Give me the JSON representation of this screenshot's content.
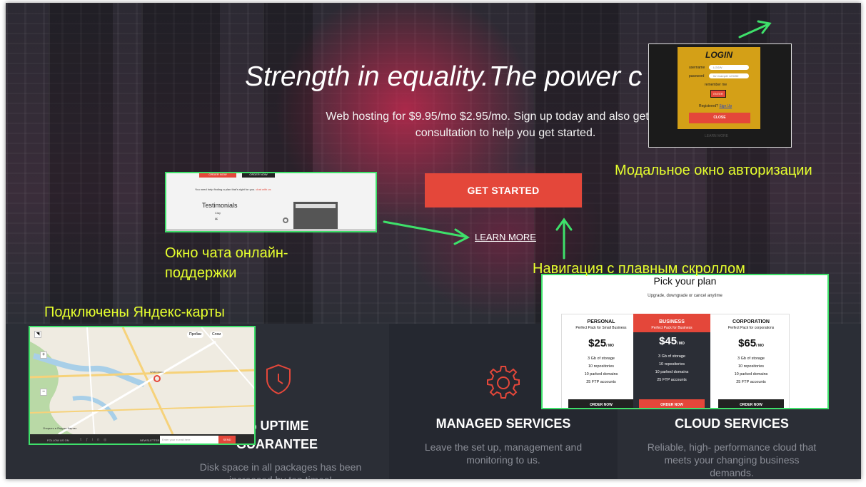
{
  "hero": {
    "title": "Strength in equality.The power c",
    "subtitle": "Web hosting for $9.95/mo $2.95/mo. Sign up today and also get 1-on-1 consultation to help you get started.",
    "cta_label": "GET STARTED",
    "learn_more_label": "LEARN MORE"
  },
  "features": [
    {
      "title": "% UPTIME\nGUARANTEE",
      "desc": "Disk space in all packages has been increased by ten times!",
      "icon": "shield-icon"
    },
    {
      "title": "MANAGED SERVICES",
      "desc": "Leave the set up, management and monitoring to us.",
      "icon": "gear-icon"
    },
    {
      "title": "CLOUD SERVICES",
      "desc": "Reliable, high- performance cloud that meets your changing business demands.",
      "icon": "cloud-icon"
    }
  ],
  "annotations": {
    "login": "Модальное окно авторизации",
    "chat": "Окно чата онлайн-\nподдержки",
    "nav": "Навигация с плавным скроллом",
    "maps": "Подключены Яндекс-карты"
  },
  "login_modal": {
    "title": "LOGIN",
    "username_label": "username",
    "username_placeholder": "LOGIN",
    "password_label": "password",
    "password_placeholder": "for example 123456",
    "remember_label": "remember me",
    "enter_label": "ENTER",
    "registered_text": "Registered?",
    "signup_label": "Sign Up",
    "close_label": "CLOSE",
    "learn_more_faint": "LEARN MORE"
  },
  "chat_window": {
    "order_label_1": "ORDER NOW",
    "order_label_2": "ORDER NOW",
    "intro": "You need help finding a plan that's right for you.",
    "intro_link": "chat with us",
    "testimonials_title": "Testimonials",
    "testimonial_name": "Clay",
    "quote_mark": "“"
  },
  "map_window": {
    "traffic_label": "Пробки",
    "layers_label": "Слои",
    "marker_label": "WebCloud",
    "open_in": "Открыть в Яндекс.Картах",
    "follow_label": "FOLLOW US ON",
    "newsletter_label": "NEWSLETTER",
    "email_placeholder": "Enter your e-mail here",
    "send_label": "SEND"
  },
  "pricing": {
    "title": "Pick your plan",
    "subtitle": "Upgrade, downgrade or cancel anytime",
    "plans": [
      {
        "name": "PERSONAL",
        "tag": "Perfect Pack for Small Business",
        "price": "25",
        "period": "/ MO",
        "features": [
          "3 Gb of storage",
          "10 repositories",
          "10 parked domains",
          "25 FTP accounts"
        ],
        "button": "ORDER NOW",
        "highlight": false
      },
      {
        "name": "BUSINESS",
        "tag": "Perfect Pack for Business",
        "price": "45",
        "period": "/ MO",
        "features": [
          "3 Gb of storage",
          "10 repositories",
          "10 parked domains",
          "25 FTP accounts"
        ],
        "button": "ORDER NOW",
        "highlight": true
      },
      {
        "name": "CORPORATION",
        "tag": "Perfect Pack for corporations",
        "price": "65",
        "period": "/ MO",
        "features": [
          "3 Gb of storage",
          "10 repositories",
          "10 parked domains",
          "25 FTP accounts"
        ],
        "button": "ORDER NOW",
        "highlight": false
      }
    ]
  },
  "colors": {
    "accent": "#e4473a",
    "highlight_green": "#3ee06a",
    "annotation_yellow": "#e6ff2e",
    "login_panel": "#d4a017"
  }
}
